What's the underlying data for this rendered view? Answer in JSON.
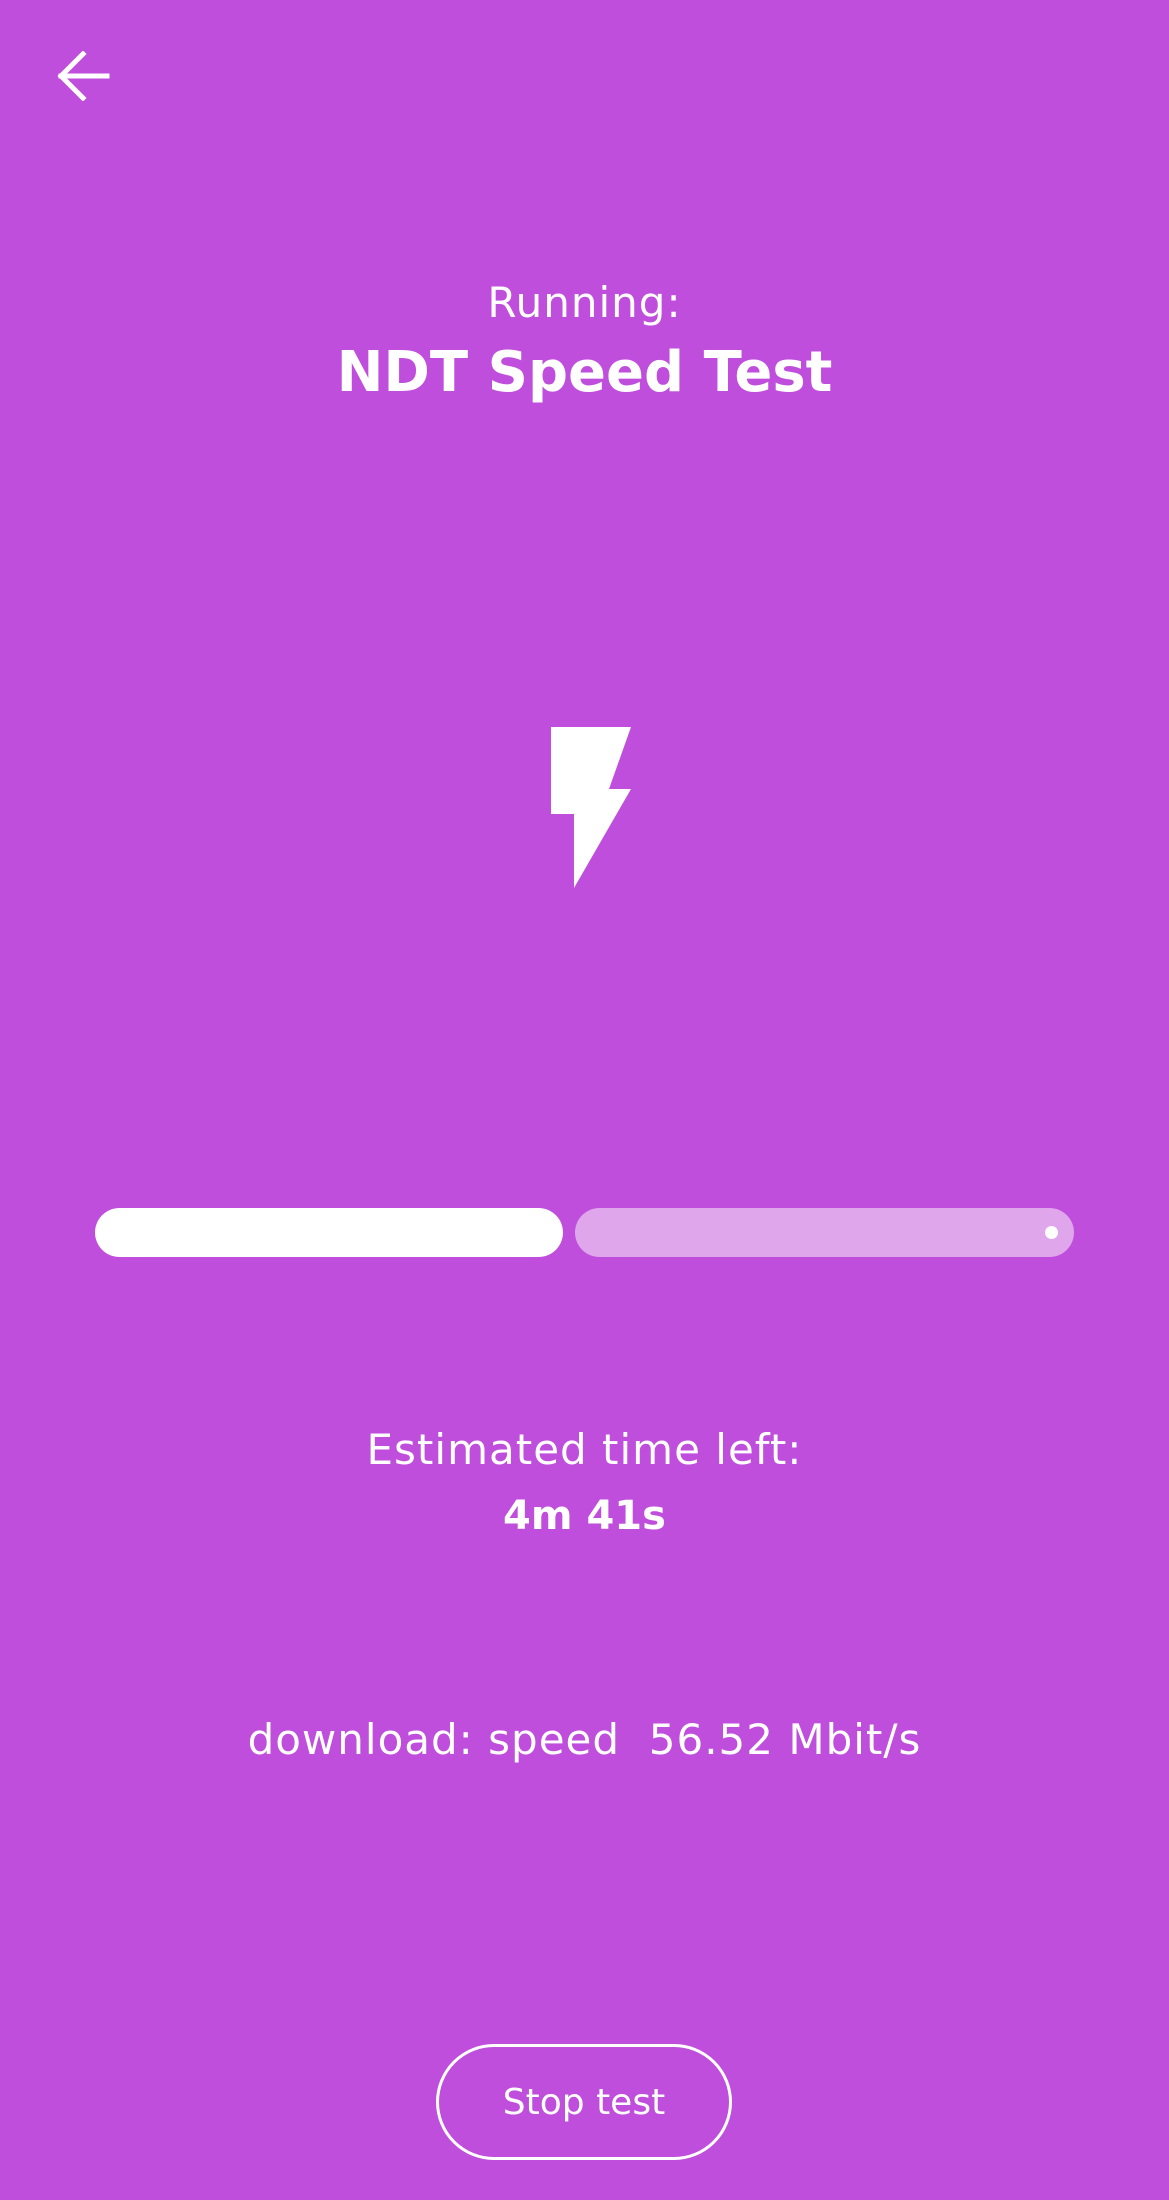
{
  "header": {
    "running_label": "Running:",
    "test_name": "NDT Speed Test"
  },
  "icons": {
    "back": "arrow-left-icon",
    "test": "lightning-bolt-icon"
  },
  "progress": {
    "segments_completed": 1,
    "segments_total": 2
  },
  "eta": {
    "label": "Estimated time left:",
    "value": "4m 41s"
  },
  "status": {
    "text": "download: speed  56.52 Mbit/s"
  },
  "actions": {
    "stop_label": "Stop test"
  },
  "colors": {
    "background": "#bf4edc",
    "foreground": "#ffffff",
    "progress_pending": "#e0a6ec"
  }
}
